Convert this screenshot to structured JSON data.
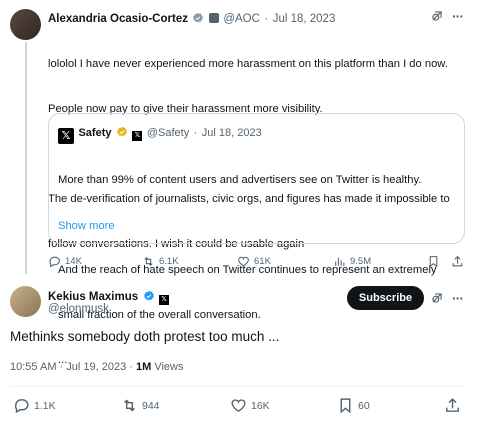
{
  "reply": {
    "author_name": "Alexandria Ocasio-Cortez",
    "handle": "@AOC",
    "date": "Jul 18, 2023",
    "text_line1": "lololol I have never experienced more harassment on this platform than I do now.",
    "text_line2": "People now pay to give their harassment more visibility.",
    "text_line3": "The de-verification of journalists, civic orgs, and figures has made it impossible to",
    "text_line4": "follow conversations. I wish it could be usable again",
    "quote": {
      "author_name": "Safety",
      "handle": "@Safety",
      "date": "Jul 18, 2023",
      "line1": "More than 99% of content users and advertisers see on Twitter is healthy.",
      "line2": "And the reach of hate speech on Twitter continues to represent an extremely",
      "line3": "small fraction of the overall conversation.",
      "line4": "...",
      "show_more": "Show more"
    },
    "stats": {
      "replies": "14K",
      "retweets": "6.1K",
      "likes": "61K",
      "views": "9.5M"
    }
  },
  "main": {
    "author_name": "Kekius Maximus",
    "handle": "@elonmusk",
    "subscribe_label": "Subscribe",
    "text": "Methinks somebody doth protest too much ...",
    "timestamp": "10:55 AM · Jul 19, 2023 ·",
    "views_count": "1M",
    "views_label": "Views",
    "stats": {
      "replies": "1.1K",
      "retweets": "944",
      "likes": "16K",
      "bookmarks": "60"
    }
  },
  "colors": {
    "verified_blue": "#1d9bf0",
    "verified_gold": "#e2b719",
    "text_secondary": "#536471"
  }
}
